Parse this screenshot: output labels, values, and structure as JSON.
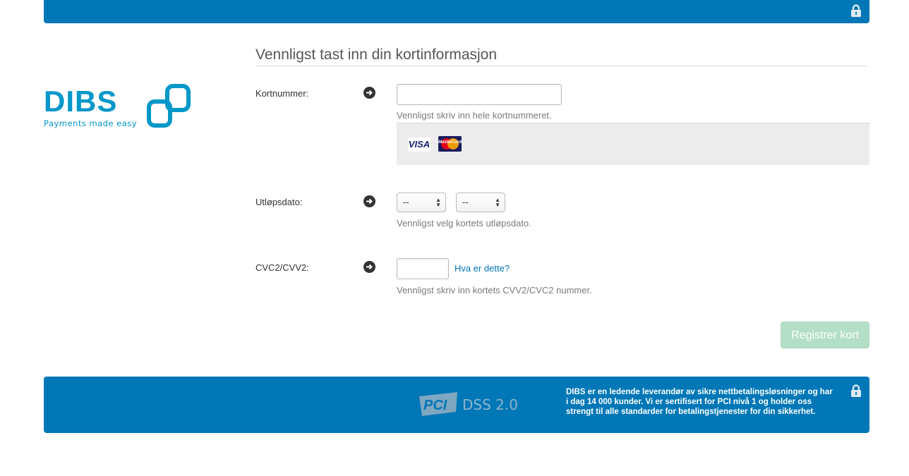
{
  "header": {
    "lock_icon": "lock-icon"
  },
  "logo": {
    "wordmark": "DIBS",
    "tagline": "Payments made easy",
    "brand_color": "#0097c9"
  },
  "form": {
    "title": "Vennligst tast inn din kortinformasjon",
    "card_number": {
      "label": "Kortnummer:",
      "value": "",
      "hint": "Vennligst skriv inn hele kortnummeret."
    },
    "accepted_cards": [
      "VISA",
      "MasterCard"
    ],
    "expiry": {
      "label": "Utløpsdato:",
      "month_selected": "--",
      "year_selected": "--",
      "hint": "Vennligst velg kortets utløpsdato."
    },
    "cvc": {
      "label": "CVC2/CVV2:",
      "value": "",
      "help_link": "Hva er dette?",
      "hint": "Vennligst skriv inn kortets CVV2/CVC2 nummer."
    },
    "submit_label": "Registrer kort"
  },
  "footer": {
    "pci_badge": "PCI",
    "pci_label": "DSS 2.0",
    "text": "DIBS er en ledende leverandør av sikre nettbetalingsløsninger og har i dag 14 000 kunder. Vi er sertifisert for PCI nivå 1 og holder oss strengt til alle standarder for betalingstjenester for din sikkerhet."
  },
  "colors": {
    "primary_blue": "#0077b6",
    "button_disabled": "#b3dfc6",
    "panel_gray": "#ececec"
  }
}
